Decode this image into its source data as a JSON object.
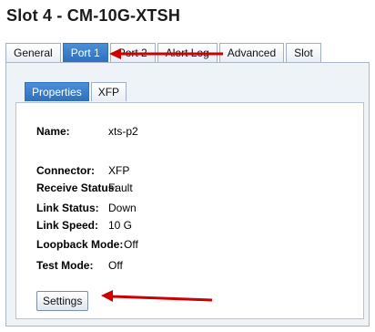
{
  "title": "Slot 4 - CM-10G-XTSH",
  "outer_tabs": [
    {
      "label": "General",
      "active": false
    },
    {
      "label": "Port 1",
      "active": true
    },
    {
      "label": "Port 2",
      "active": false
    },
    {
      "label": "Alert Log",
      "active": false
    },
    {
      "label": "Advanced",
      "active": false
    },
    {
      "label": "Slot",
      "active": false
    }
  ],
  "inner_tabs": [
    {
      "label": "Properties",
      "active": true
    },
    {
      "label": "XFP",
      "active": false
    }
  ],
  "properties": {
    "name": {
      "label": "Name:",
      "value": "xts-p2"
    },
    "connector": {
      "label": "Connector:",
      "value": "XFP"
    },
    "receive_status": {
      "label": "Receive Status:",
      "value": "Fault"
    },
    "link_status": {
      "label": "Link Status:",
      "value": "Down"
    },
    "link_speed": {
      "label": "Link Speed:",
      "value": "10 G"
    },
    "loopback_mode": {
      "label": "Loopback Mode:",
      "value": "Off"
    },
    "test_mode": {
      "label": "Test Mode:",
      "value": "Off"
    }
  },
  "settings_button": "Settings",
  "colors": {
    "accent": "#2f6fbf",
    "annotation_arrow": "#cc0000"
  }
}
